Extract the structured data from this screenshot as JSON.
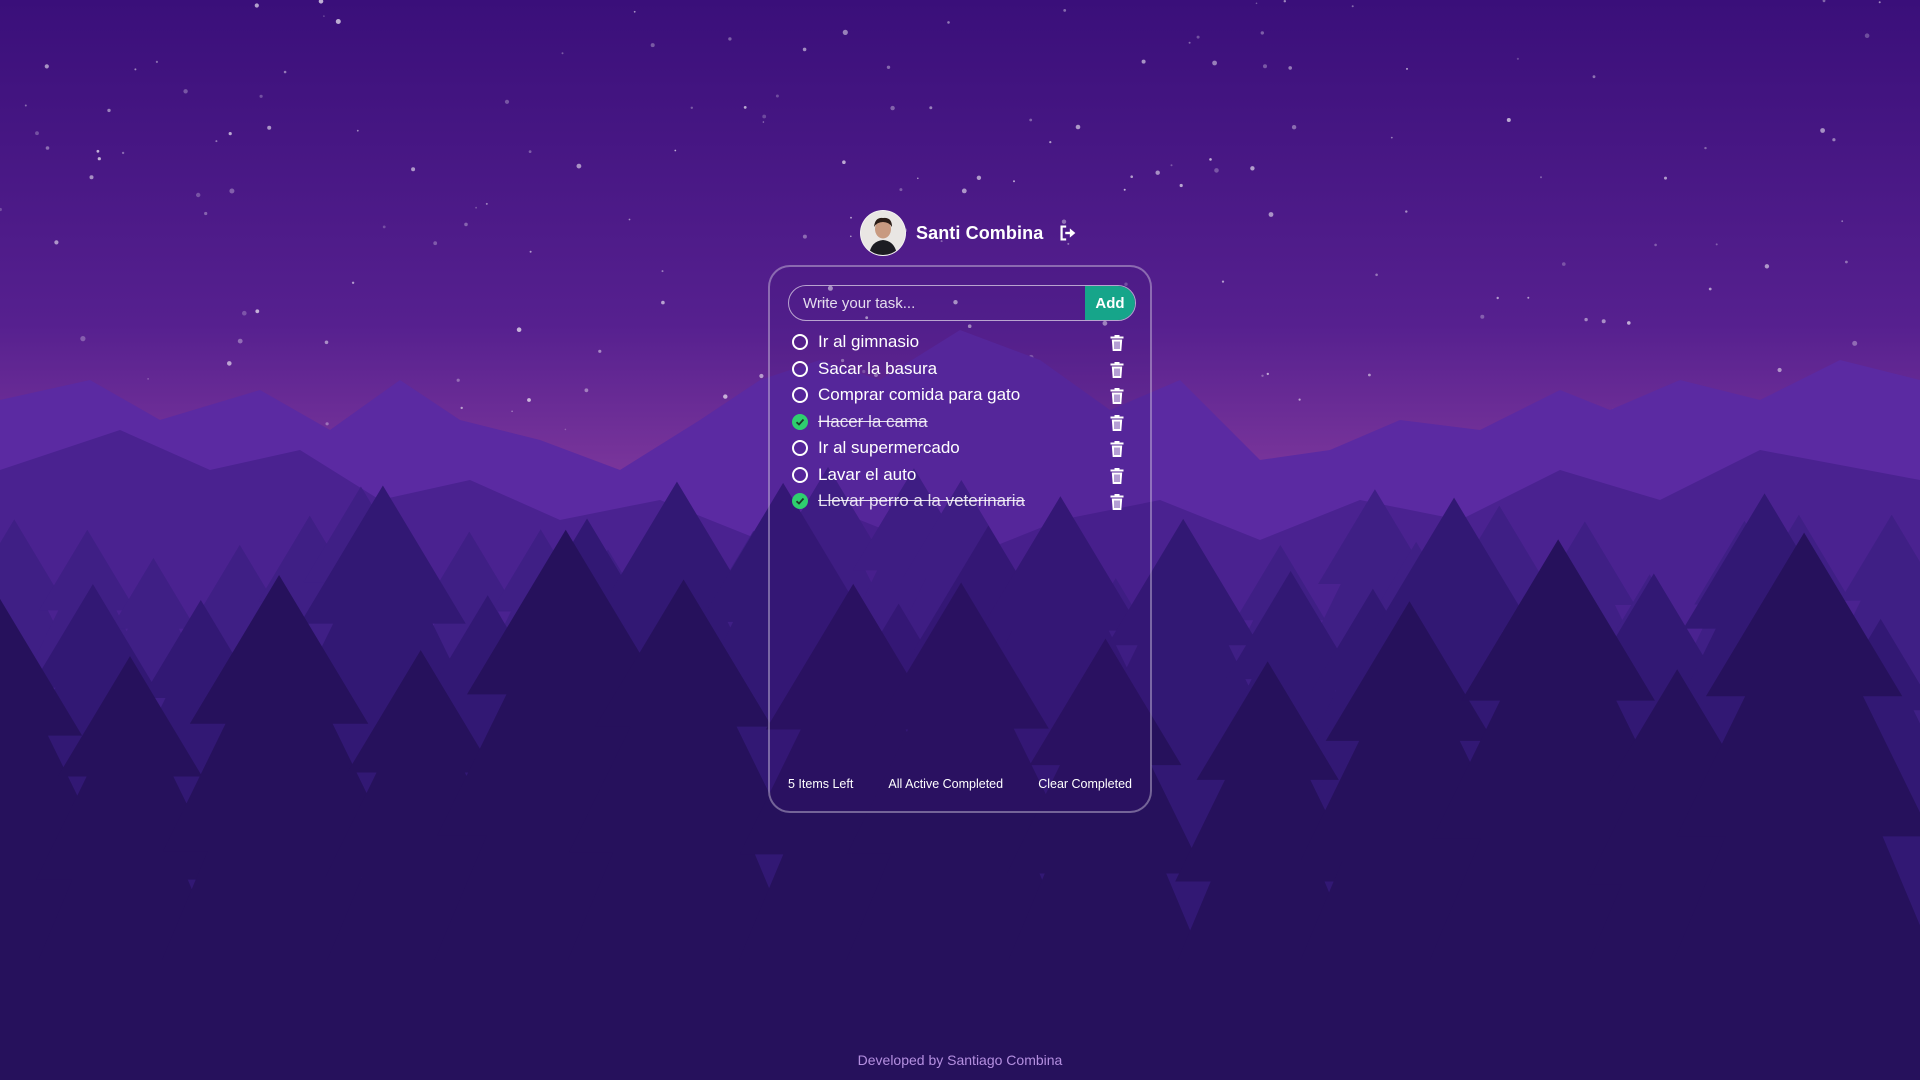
{
  "user": {
    "name": "Santi Combina"
  },
  "input": {
    "placeholder": "Write your task...",
    "value": ""
  },
  "add_button": {
    "label": "Add"
  },
  "tasks": [
    {
      "text": "Ir al gimnasio",
      "completed": false
    },
    {
      "text": "Sacar la basura",
      "completed": false
    },
    {
      "text": "Comprar comida para gato",
      "completed": false
    },
    {
      "text": "Hacer la cama",
      "completed": true
    },
    {
      "text": "Ir al supermercado",
      "completed": false
    },
    {
      "text": "Lavar el auto",
      "completed": false
    },
    {
      "text": "Llevar perro a la veterinaria",
      "completed": true
    }
  ],
  "footer": {
    "items_left": "5 Items Left",
    "filter_all": "All",
    "filter_active": "Active",
    "filter_completed": "Completed",
    "clear_completed": "Clear Completed"
  },
  "credit": "Developed by Santiago Combina",
  "colors": {
    "accent": "#16a58a",
    "check_done": "#2fcf6f",
    "sky_top": "#3a0f7a",
    "sky_glow": "#8a3fa0"
  }
}
